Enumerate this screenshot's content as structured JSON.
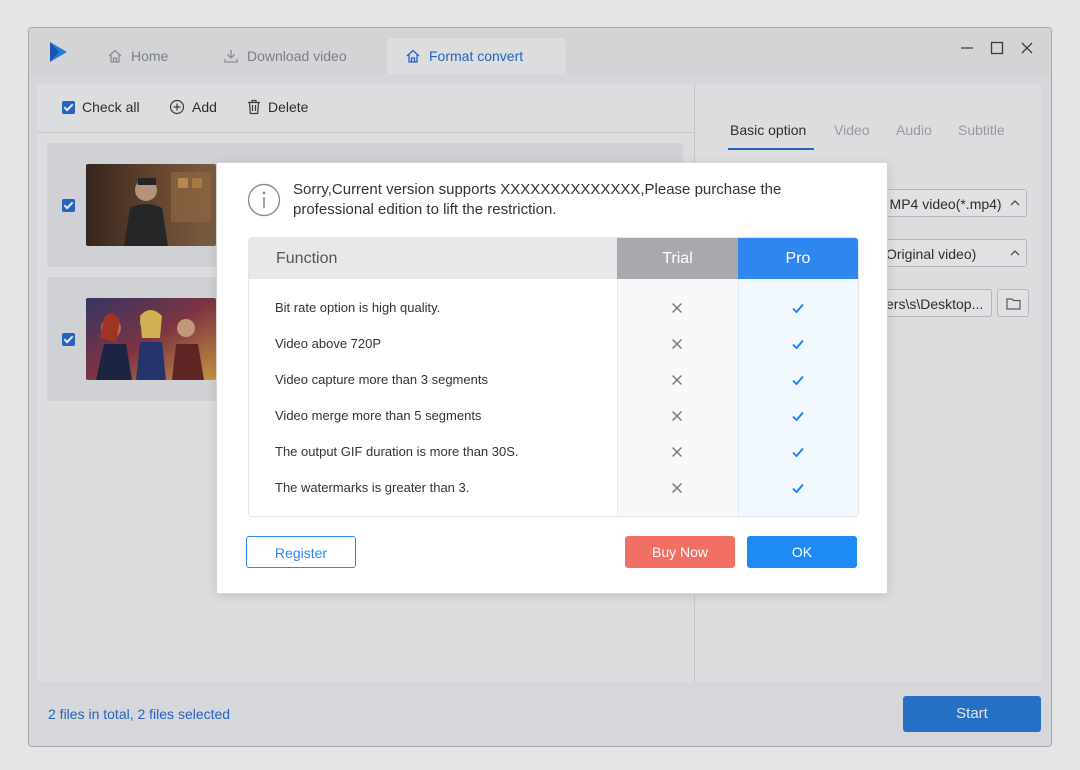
{
  "tabs": [
    {
      "label": "Home",
      "icon": "home-icon"
    },
    {
      "label": "Download video",
      "icon": "download-icon"
    },
    {
      "label": "Format convert",
      "icon": "home-icon"
    }
  ],
  "toolbar": {
    "check_all": "Check all",
    "add": "Add",
    "delete": "Delete"
  },
  "files": [
    {
      "checked": true
    },
    {
      "checked": true
    }
  ],
  "right_tabs": [
    "Basic option",
    "Video",
    "Audio",
    "Subtitle"
  ],
  "right_fields": {
    "format": "m MP4 video(*.mp4)",
    "quality": "Original video)",
    "output_path": "ers\\s\\Desktop..."
  },
  "status": "2 files in total, 2 files selected",
  "start_label": "Start",
  "dialog": {
    "message": "Sorry,Current version supports XXXXXXXXXXXXXX,Please purchase the professional edition to lift the restriction.",
    "table": {
      "headers": {
        "function": "Function",
        "trial": "Trial",
        "pro": "Pro"
      },
      "rows": [
        {
          "function": "Bit rate option is high quality.",
          "trial": false,
          "pro": true
        },
        {
          "function": "Video above 720P",
          "trial": false,
          "pro": true
        },
        {
          "function": "Video capture more than 3 segments",
          "trial": false,
          "pro": true
        },
        {
          "function": "Video merge more than 5 segments",
          "trial": false,
          "pro": true
        },
        {
          "function": "The output GIF duration is more than 30S.",
          "trial": false,
          "pro": true
        },
        {
          "function": "The  watermarks is greater than 3.",
          "trial": false,
          "pro": true
        }
      ]
    },
    "register": "Register",
    "buy_now": "Buy Now",
    "ok": "OK"
  },
  "colors": {
    "accent": "#2a6fd6",
    "pro_header": "#2f86ef",
    "trial_header": "#a8a9ad",
    "buy_button": "#f26f64",
    "ok_button": "#1d8bf3"
  }
}
